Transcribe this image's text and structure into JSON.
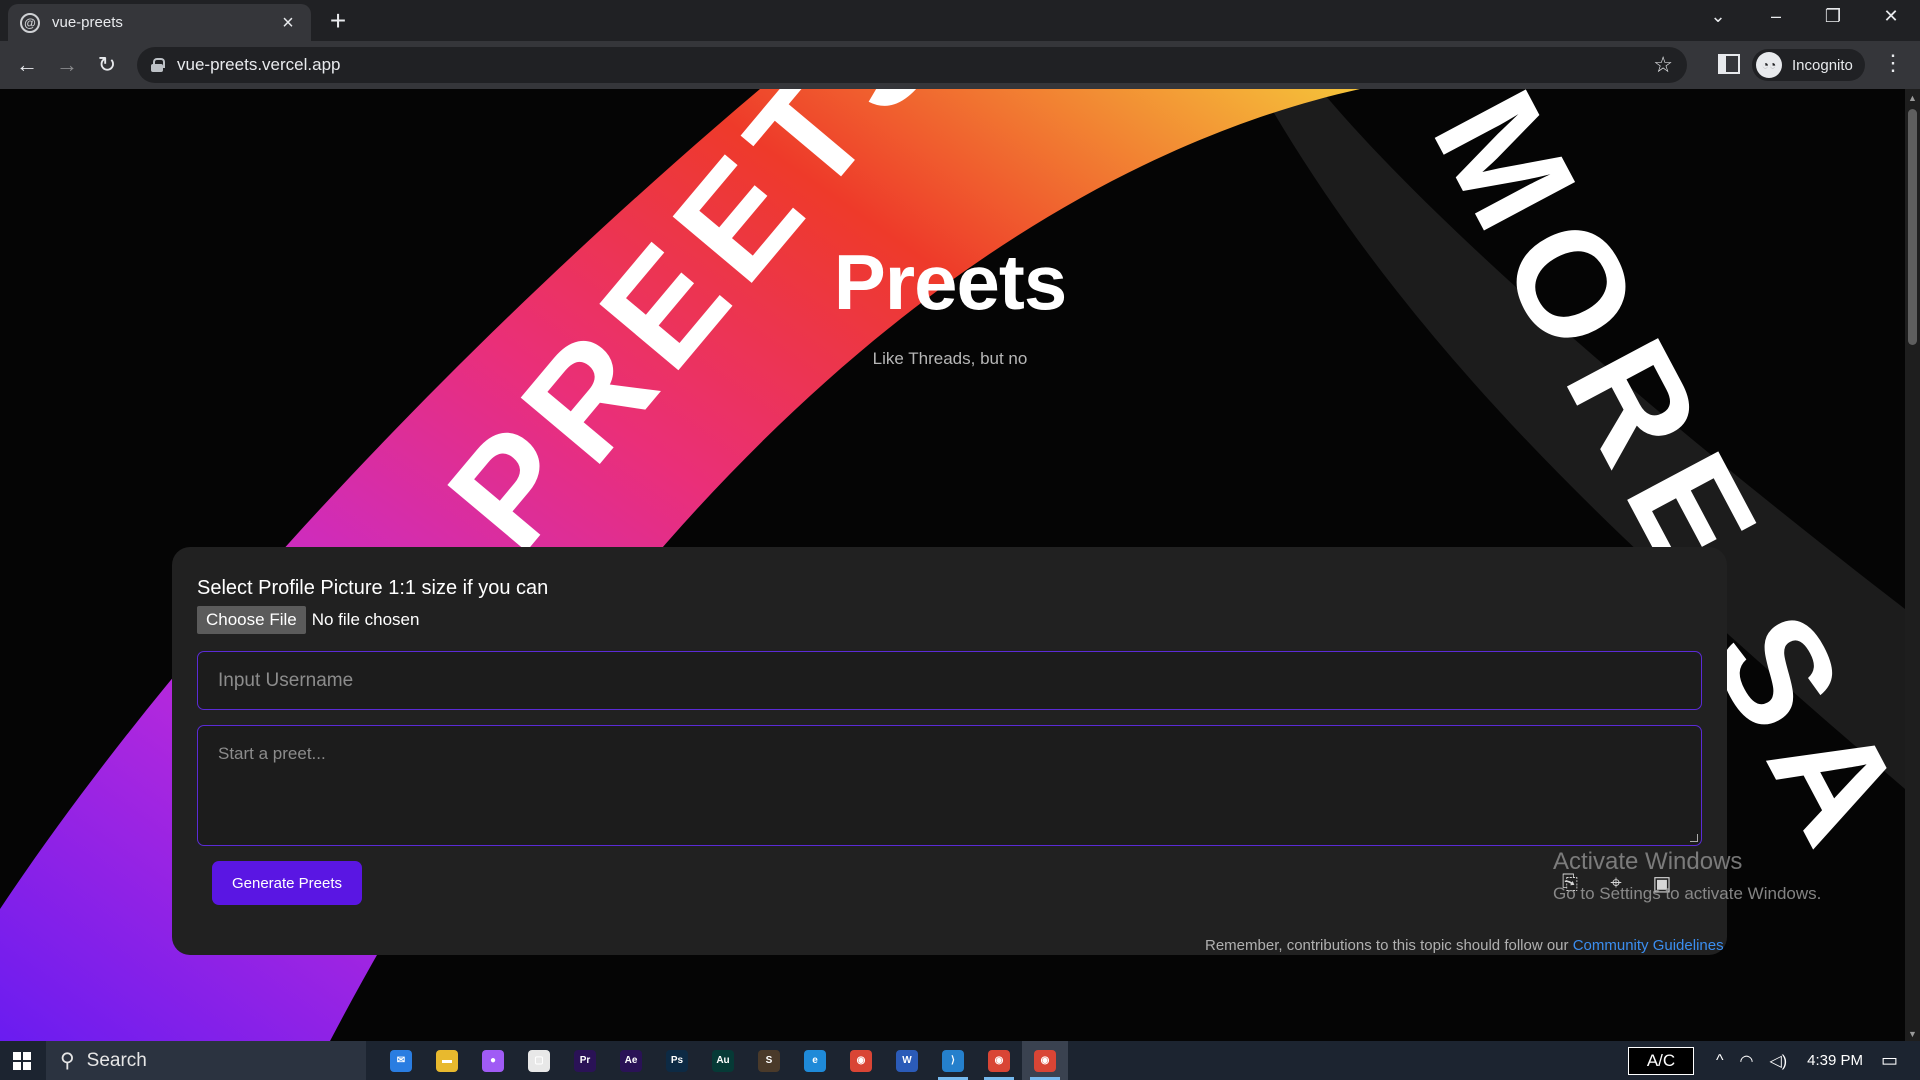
{
  "browser": {
    "tab_title": "vue-preets",
    "url": "vue-preets.vercel.app",
    "profile_label": "Incognito"
  },
  "page": {
    "title": "Preets",
    "subtitle": "Like Threads, but no",
    "background_texts": [
      "PREETS",
      "MORE SA"
    ],
    "form": {
      "picture_label": "Select Profile Picture 1:1 size if you can",
      "choose_file_label": "Choose File",
      "no_file_text": "No file chosen",
      "username_placeholder": "Input Username",
      "preet_placeholder": "Start a preet...",
      "generate_label": "Generate Preets"
    },
    "footnote_text": "Remember, contributions to this topic should follow our",
    "footnote_link": "Community Guidelines"
  },
  "watermark": {
    "line1": "Activate Windows",
    "line2": "Go to Settings to activate Windows."
  },
  "taskbar": {
    "search_label": "Search",
    "apps": [
      {
        "name": "mail-icon",
        "glyph": "✉",
        "color": "#2a7de1"
      },
      {
        "name": "file-explorer-icon",
        "glyph": "▬",
        "color": "#e8b92e"
      },
      {
        "name": "arc-browser-icon",
        "glyph": "●",
        "color": "#a05bf5"
      },
      {
        "name": "twitch-icon",
        "glyph": "▢",
        "color": "#e8e8e8"
      },
      {
        "name": "premiere-pro-icon",
        "glyph": "Pr",
        "color": "#2a1256"
      },
      {
        "name": "after-effects-icon",
        "glyph": "Ae",
        "color": "#2a1256"
      },
      {
        "name": "photoshop-icon",
        "glyph": "Ps",
        "color": "#0d2a44"
      },
      {
        "name": "audition-icon",
        "glyph": "Au",
        "color": "#063a36"
      },
      {
        "name": "sublime-text-icon",
        "glyph": "S",
        "color": "#4a3a2a"
      },
      {
        "name": "edge-icon",
        "glyph": "e",
        "color": "#1f8ad8"
      },
      {
        "name": "chrome-icon",
        "glyph": "◉",
        "color": "#d94535"
      },
      {
        "name": "word-icon",
        "glyph": "W",
        "color": "#2b5bb8"
      },
      {
        "name": "vscode-icon",
        "glyph": "⟩",
        "color": "#2580cc"
      },
      {
        "name": "chrome-icon-2",
        "glyph": "◉",
        "color": "#d94535"
      },
      {
        "name": "chrome-icon-3",
        "glyph": "◉",
        "color": "#d94535"
      }
    ],
    "ac_label": "A/C",
    "clock": "4:39 PM"
  }
}
